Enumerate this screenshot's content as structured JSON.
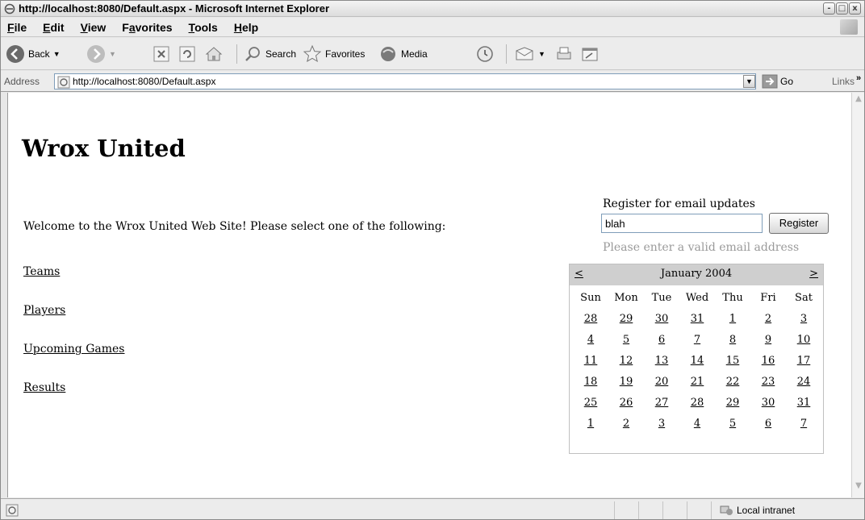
{
  "window": {
    "title": "http://localhost:8080/Default.aspx - Microsoft Internet Explorer",
    "buttons": [
      "-",
      "□",
      "x"
    ]
  },
  "menu": [
    {
      "label": "File",
      "u": "F",
      "rest": "ile"
    },
    {
      "label": "Edit",
      "u": "E",
      "rest": "dit"
    },
    {
      "label": "View",
      "u": "V",
      "rest": "iew"
    },
    {
      "label": "Favorites",
      "pre": "F",
      "u": "a",
      "rest": "vorites"
    },
    {
      "label": "Tools",
      "u": "T",
      "rest": "ools"
    },
    {
      "label": "Help",
      "u": "H",
      "rest": "elp"
    }
  ],
  "toolbar": {
    "back": "Back",
    "search": "Search",
    "favorites": "Favorites",
    "media": "Media"
  },
  "address": {
    "label": "Address",
    "url": "http://localhost:8080/Default.aspx",
    "go": "Go",
    "links": "Links",
    "chevron": "»"
  },
  "page": {
    "title": "Wrox United",
    "welcome": "Welcome to the Wrox United Web Site! Please select one of the following:",
    "links": [
      "Teams",
      "Players",
      "Upcoming Games",
      "Results"
    ],
    "register": {
      "label": "Register for email updates",
      "value": "blah",
      "button": "Register",
      "error": "Please enter a valid email address"
    }
  },
  "calendar": {
    "prev": "<",
    "next": ">",
    "month": "January 2004",
    "days": [
      "Sun",
      "Mon",
      "Tue",
      "Wed",
      "Thu",
      "Fri",
      "Sat"
    ],
    "weeks": [
      [
        "28",
        "29",
        "30",
        "31",
        "1",
        "2",
        "3"
      ],
      [
        "4",
        "5",
        "6",
        "7",
        "8",
        "9",
        "10"
      ],
      [
        "11",
        "12",
        "13",
        "14",
        "15",
        "16",
        "17"
      ],
      [
        "18",
        "19",
        "20",
        "21",
        "22",
        "23",
        "24"
      ],
      [
        "25",
        "26",
        "27",
        "28",
        "29",
        "30",
        "31"
      ],
      [
        "1",
        "2",
        "3",
        "4",
        "5",
        "6",
        "7"
      ]
    ]
  },
  "status": {
    "zone": "Local intranet"
  },
  "colors": {
    "chrome": "#ececec",
    "calendar_header": "#cfcfcf",
    "error_text": "#9a9a9a"
  }
}
